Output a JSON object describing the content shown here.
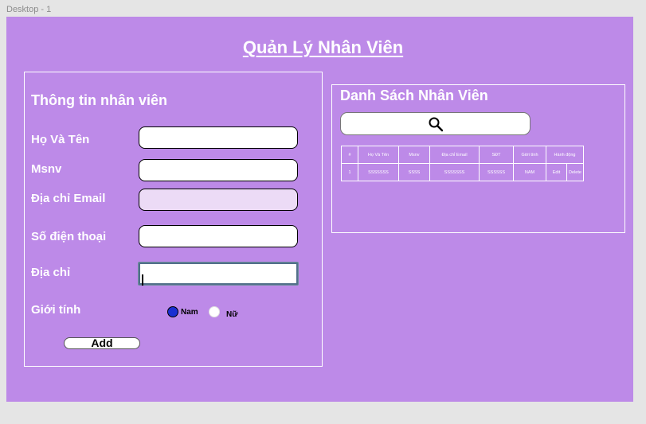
{
  "frame_label": "Desktop - 1",
  "page_title": "Quản Lý Nhân Viên",
  "form": {
    "heading": "Thông tin nhân viên",
    "fields": [
      {
        "label": "Họ Và Tên",
        "value": ""
      },
      {
        "label": "Msnv",
        "value": ""
      },
      {
        "label": "Địa chỉ Email",
        "value": ""
      },
      {
        "label": "Số điện thoại",
        "value": ""
      },
      {
        "label": "Địa chỉ",
        "value": ""
      }
    ],
    "gender_label": "Giới tính",
    "gender_options": [
      {
        "label": "Nam",
        "selected": true
      },
      {
        "label": "Nữ",
        "selected": false
      }
    ],
    "add_label": "Add"
  },
  "list": {
    "heading": "Danh Sách Nhân Viên",
    "search_icon": "search-icon",
    "columns": [
      "#",
      "Họ Và Tên",
      "Msnv",
      "Địa chỉ Email",
      "SĐT",
      "Giới tính",
      "Hành động"
    ],
    "rows": [
      {
        "index": "1",
        "name": "SSSSSSS",
        "msnv": "SSSS",
        "email": "SSSSSSS",
        "phone": "SSSSSS",
        "gender": "NAM",
        "edit": "Edit",
        "delete": "Delete"
      }
    ]
  },
  "colors": {
    "background": "#bd8ae8",
    "canvas": "#e5e5e5",
    "radio_selected": "#1a2fd1",
    "disabled_input": "#ecdbf6"
  }
}
